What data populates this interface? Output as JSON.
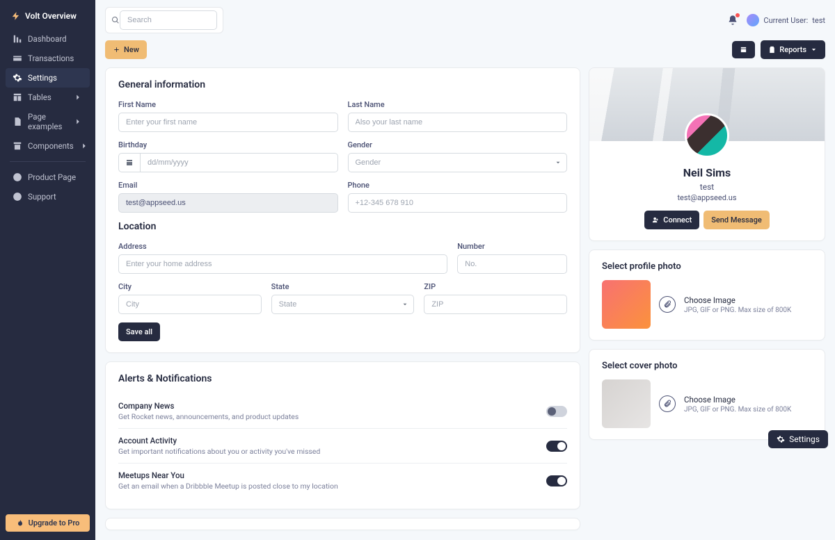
{
  "brand": "Volt Overview",
  "sidebar": {
    "items": [
      {
        "label": "Dashboard",
        "icon": "chart"
      },
      {
        "label": "Transactions",
        "icon": "card"
      },
      {
        "label": "Settings",
        "icon": "gear",
        "active": true
      },
      {
        "label": "Tables",
        "icon": "table",
        "chev": true
      },
      {
        "label": "Page examples",
        "icon": "page",
        "chev": true
      },
      {
        "label": "Components",
        "icon": "archive",
        "chev": true
      }
    ],
    "secondary": [
      {
        "label": "Product Page",
        "icon": "info"
      },
      {
        "label": "Support",
        "icon": "plus"
      }
    ],
    "upgrade": "Upgrade to Pro"
  },
  "topbar": {
    "search_placeholder": "Search",
    "current_user_prefix": "Current User: ",
    "current_user_name": "test"
  },
  "actions": {
    "new": "New",
    "reports": "Reports"
  },
  "general": {
    "title": "General information",
    "first_name_label": "First Name",
    "first_name_ph": "Enter your first name",
    "last_name_label": "Last Name",
    "last_name_ph": "Also your last name",
    "birthday_label": "Birthday",
    "birthday_ph": "dd/mm/yyyy",
    "gender_label": "Gender",
    "gender_ph": "Gender",
    "email_label": "Email",
    "email_value": "test@appseed.us",
    "phone_label": "Phone",
    "phone_ph": "+12-345 678 910"
  },
  "location": {
    "title": "Location",
    "address_label": "Address",
    "address_ph": "Enter your home address",
    "number_label": "Number",
    "number_ph": "No.",
    "city_label": "City",
    "city_ph": "City",
    "state_label": "State",
    "state_ph": "State",
    "zip_label": "ZIP",
    "zip_ph": "ZIP",
    "save_all": "Save all"
  },
  "alerts": {
    "title": "Alerts & Notifications",
    "items": [
      {
        "title": "Company News",
        "desc": "Get Rocket news, announcements, and product updates",
        "on": false
      },
      {
        "title": "Account Activity",
        "desc": "Get important notifications about you or activity you've missed",
        "on": true
      },
      {
        "title": "Meetups Near You",
        "desc": "Get an email when a Dribbble Meetup is posted close to my location",
        "on": true
      }
    ]
  },
  "profile": {
    "name": "Neil Sims",
    "role": "test",
    "email": "test@appseed.us",
    "connect": "Connect",
    "send": "Send Message"
  },
  "photo": {
    "profile_title": "Select profile photo",
    "cover_title": "Select cover photo",
    "choose": "Choose Image",
    "hint": "JPG, GIF or PNG. Max size of 800K"
  },
  "fab": "Settings"
}
